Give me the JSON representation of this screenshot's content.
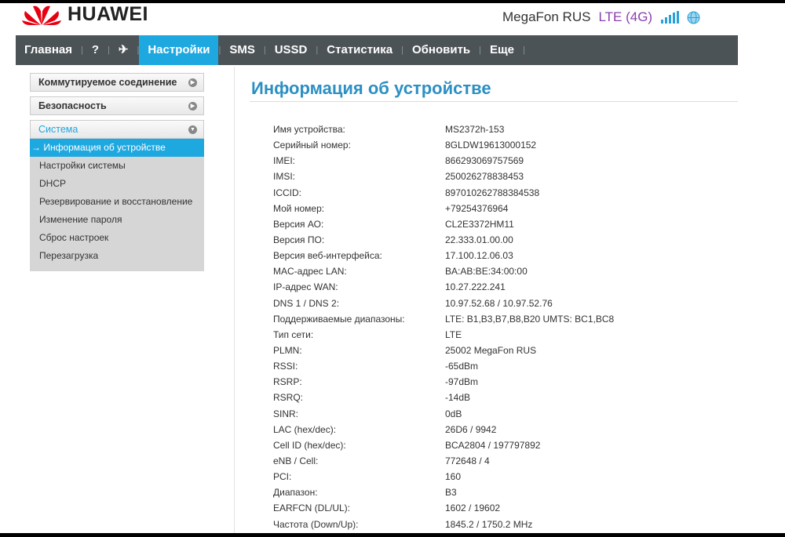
{
  "header": {
    "brand": "HUAWEI",
    "operator": "MegaFon RUS",
    "network": "LTE (4G)"
  },
  "nav": [
    {
      "label": "Главная"
    },
    {
      "label": "?"
    },
    {
      "label": "Настройки",
      "active": true
    },
    {
      "label": "SMS"
    },
    {
      "label": "USSD"
    },
    {
      "label": "Статистика"
    },
    {
      "label": "Обновить"
    },
    {
      "label": "Еще"
    }
  ],
  "sidebar": {
    "sections": [
      "Коммутируемое соединение",
      "Безопасность",
      "Система"
    ],
    "system_items": [
      "→ Информация об устройстве",
      "Настройки системы",
      "DHCP",
      "Резервирование и восстановление",
      "Изменение пароля",
      "Сброс настроек",
      "Перезагрузка"
    ]
  },
  "page": {
    "title": "Информация об устройстве",
    "rows": [
      [
        "Имя устройства:",
        "MS2372h-153"
      ],
      [
        "Серийный номер:",
        "8GLDW19613000152"
      ],
      [
        "IMEI:",
        "866293069757569"
      ],
      [
        "IMSI:",
        "250026278838453"
      ],
      [
        "ICCID:",
        "897010262788384538"
      ],
      [
        "Мой номер:",
        "+79254376964"
      ],
      [
        "Версия АО:",
        "CL2E3372HM11"
      ],
      [
        "Версия ПО:",
        "22.333.01.00.00"
      ],
      [
        "Версия веб-интерфейса:",
        "17.100.12.06.03"
      ],
      [
        "MAC-адрес LAN:",
        "BA:AB:BE:34:00:00"
      ],
      [
        "IP-адрес WAN:",
        "10.27.222.241"
      ],
      [
        "DNS 1 / DNS 2:",
        "10.97.52.68 / 10.97.52.76"
      ],
      [
        "Поддерживаемые диапазоны:",
        "LTE: B1,B3,B7,B8,B20 UMTS: BC1,BC8"
      ],
      [
        "Тип сети:",
        "LTE"
      ],
      [
        "PLMN:",
        "25002 MegaFon RUS"
      ],
      [
        "RSSI:",
        "-65dBm"
      ],
      [
        "RSRP:",
        "-97dBm"
      ],
      [
        "RSRQ:",
        "-14dB"
      ],
      [
        "SINR:",
        "0dB"
      ],
      [
        "LAC (hex/dec):",
        "26D6 / 9942"
      ],
      [
        "Cell ID (hex/dec):",
        "BCA2804 / 197797892"
      ],
      [
        "eNB / Cell:",
        "772648 / 4"
      ],
      [
        "PCI:",
        "160"
      ],
      [
        "Диапазон:",
        "B3"
      ],
      [
        "EARFCN (DL/UL):",
        "1602 / 19602"
      ],
      [
        "Частота (Down/Up):",
        "1845.2 / 1750.2 MHz"
      ]
    ]
  }
}
